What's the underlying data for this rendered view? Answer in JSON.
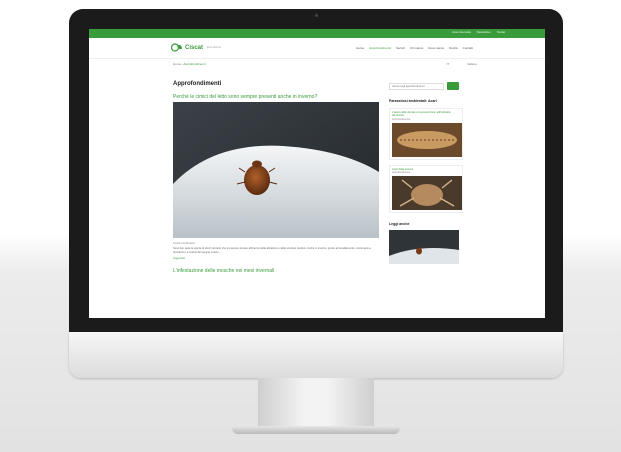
{
  "topbar": {
    "links": [
      "Area riservata",
      "Newsletter",
      "Social"
    ]
  },
  "header": {
    "logo": "Ciscat",
    "logo_sub": "Pest Control",
    "nav": [
      {
        "label": "Home",
        "active": false
      },
      {
        "label": "Approfondimenti",
        "active": true
      },
      {
        "label": "Servizi",
        "active": false
      },
      {
        "label": "Chi siamo",
        "active": false
      },
      {
        "label": "Dove siamo",
        "active": false
      },
      {
        "label": "Novità",
        "active": false
      },
      {
        "label": "Contatti",
        "active": false
      }
    ]
  },
  "breadcrumb": {
    "home": "Home",
    "current": "Approfondimenti"
  },
  "breadcrumb_right": [
    "IT",
    "Italiano"
  ],
  "main": {
    "page_title": "Approfondimenti",
    "post": {
      "title": "Perché le cimici del letto sono sempre presenti anche in inverno?",
      "meta": "Insetti ed infestanti",
      "excerpt": "Sono ben sette le specie di cimici del letto che si possono trovare all'interno delle abitazioni e delle strutture ricettive. Anche in inverno, grazie al riscaldamento, continuano a riprodursi e a nutrirsi del sangue umano...",
      "read_more": "Leggi tutto"
    },
    "post2_title": "L'infestazione delle mosche nei mesi invernali"
  },
  "sidebar": {
    "search_placeholder": "Cerca negli approfondimenti",
    "heading": "Parassitosi ambientali: Acari",
    "card1_title": "L'acaro delle derrate e la prevenzione nell'industria alimentare",
    "card1_sub": "Approfondimento",
    "card2_title": "Acari della polvere",
    "card2_sub": "Approfondimento",
    "heading2": "Leggi anche"
  },
  "colors": {
    "accent": "#3a9b3a",
    "bezel": "#1b1b1b"
  }
}
